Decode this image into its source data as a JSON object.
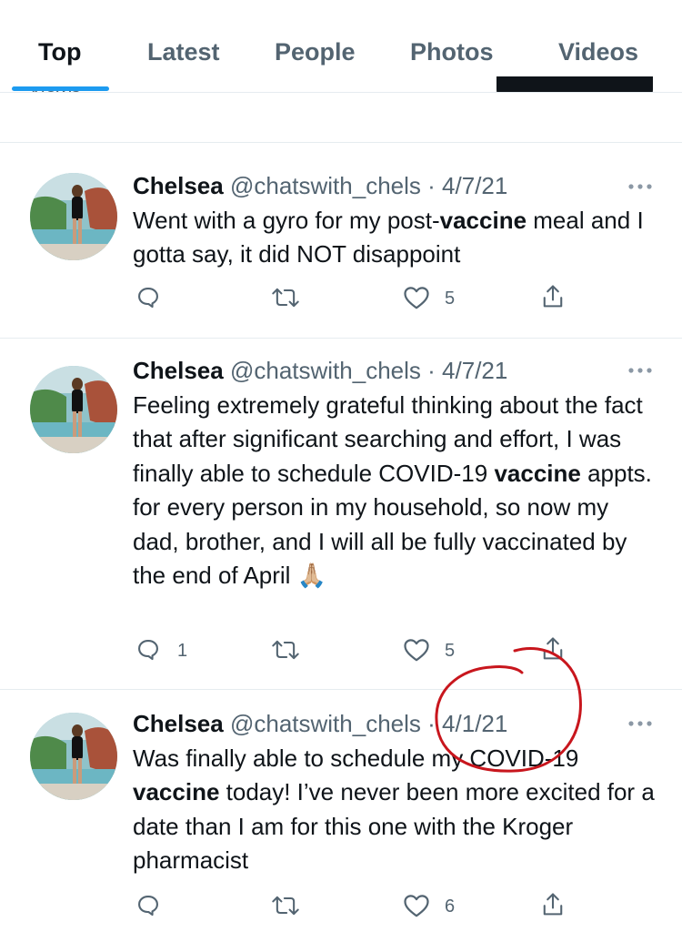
{
  "tabs": [
    {
      "label": "Top",
      "active": true
    },
    {
      "label": "Latest",
      "active": false
    },
    {
      "label": "People",
      "active": false
    },
    {
      "label": "Photos",
      "active": false
    },
    {
      "label": "Videos",
      "active": false
    }
  ],
  "peek": {
    "label": "News"
  },
  "tweets": [
    {
      "name": "Chelsea",
      "handle": "@chatswith_chels",
      "separator": "·",
      "date": "4/7/21",
      "text_parts": [
        "Went with a gyro for my post-",
        "vaccine",
        " meal and I gotta say, it did NOT disappoint"
      ],
      "reply_count": "",
      "like_count": "5"
    },
    {
      "name": "Chelsea",
      "handle": "@chatswith_chels",
      "separator": "·",
      "date": "4/7/21",
      "text_parts": [
        "Feeling extremely grateful thinking about the fact that after significant searching and effort, I was finally able to schedule COVID-19 ",
        "vaccine",
        " appts. for every person in my household, so now my dad, brother, and I will all be fully vaccinated by the end of April 🙏🏼"
      ],
      "reply_count": "1",
      "like_count": "5"
    },
    {
      "name": "Chelsea",
      "handle": "@chatswith_chels",
      "separator": "·",
      "date": "4/1/21",
      "text_parts": [
        "Was finally able to schedule my COVID-19 ",
        "vaccine",
        " today! I’ve never been more excited for a date than I am for this one with the Kroger pharmacist"
      ],
      "reply_count": "",
      "like_count": "6"
    }
  ],
  "icons": {
    "reply": "reply-icon",
    "retweet": "retweet-icon",
    "like": "heart-icon",
    "share": "share-icon",
    "more": "more-icon"
  },
  "colors": {
    "accent": "#1d9bf0",
    "annotation": "#c8161d",
    "secondary_text": "#536471"
  }
}
